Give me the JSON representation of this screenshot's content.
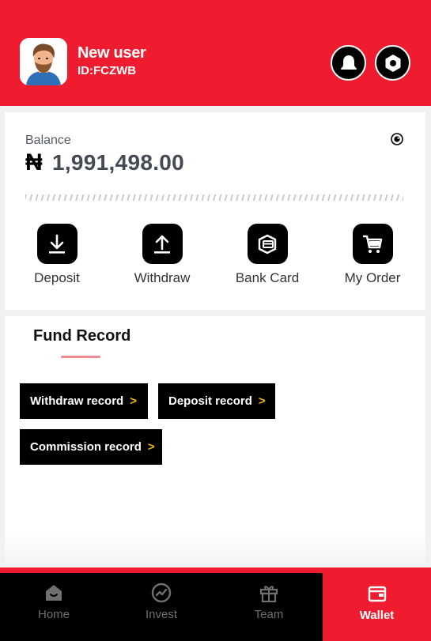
{
  "header": {
    "user_name": "New user",
    "user_id": "ID:FCZWB",
    "brand_color": "#ee1c2e",
    "icons": [
      "bell-icon",
      "settings-icon"
    ]
  },
  "balance": {
    "label": "Balance",
    "currency_symbol": "₦",
    "amount": "1,991,498.00"
  },
  "actions": [
    {
      "label": "Deposit",
      "icon": "download-icon"
    },
    {
      "label": "Withdraw",
      "icon": "upload-icon"
    },
    {
      "label": "Bank Card",
      "icon": "bank-card-icon"
    },
    {
      "label": "My Order",
      "icon": "cart-icon"
    }
  ],
  "fund_record": {
    "title": "Fund Record",
    "buttons": [
      {
        "label": "Withdraw record",
        "chevron": ">"
      },
      {
        "label": "Deposit record",
        "chevron": ">"
      },
      {
        "label": "Commission record",
        "chevron": ">"
      }
    ]
  },
  "nav": {
    "items": [
      {
        "label": "Home",
        "icon": "home-icon"
      },
      {
        "label": "Invest",
        "icon": "trend-icon"
      },
      {
        "label": "Team",
        "icon": "gift-icon"
      },
      {
        "label": "Wallet",
        "icon": "wallet-icon",
        "active": true
      }
    ]
  }
}
